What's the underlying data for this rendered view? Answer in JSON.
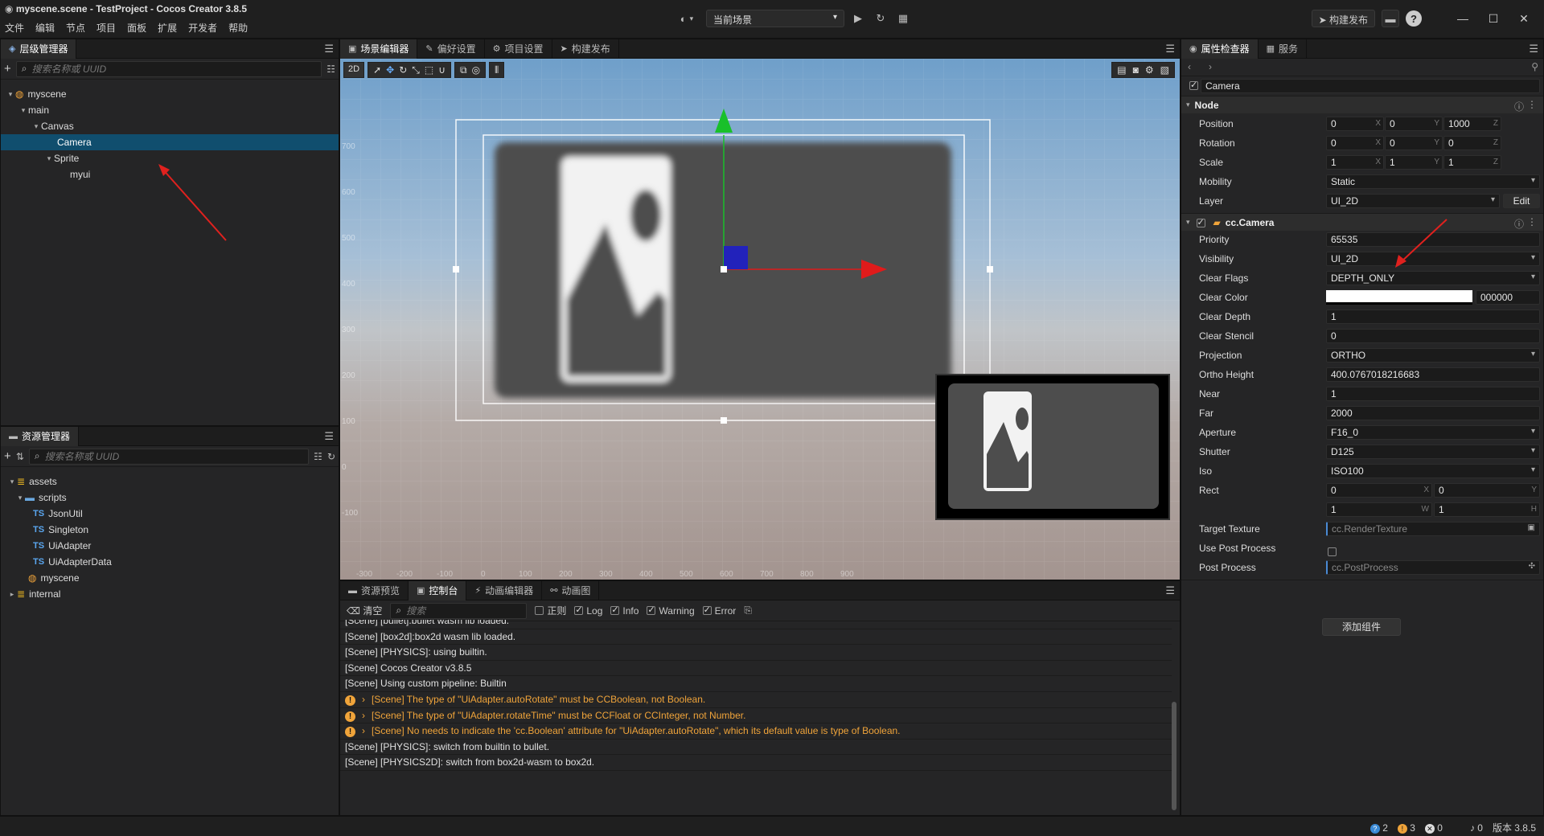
{
  "window": {
    "title": "myscene.scene - TestProject - Cocos Creator 3.8.5"
  },
  "menu": [
    "文件",
    "编辑",
    "节点",
    "项目",
    "面板",
    "扩展",
    "开发者",
    "帮助"
  ],
  "toolbar": {
    "scene_select": "当前场景",
    "build_publish": "构建发布"
  },
  "hierarchy": {
    "tab": "层级管理器",
    "search_placeholder": "搜索名称或 UUID",
    "nodes": [
      "myscene",
      "main",
      "Canvas",
      "Camera",
      "Sprite",
      "myui"
    ],
    "selected": "Camera"
  },
  "assets": {
    "tab": "资源管理器",
    "search_placeholder": "搜索名称或 UUID",
    "items": [
      "assets",
      "scripts",
      "JsonUtil",
      "Singleton",
      "UiAdapter",
      "UiAdapterData",
      "myscene",
      "internal"
    ],
    "ts_badge": "TS"
  },
  "scene_editor": {
    "tabs": [
      "场景编辑器",
      "偏好设置",
      "项目设置",
      "构建发布"
    ],
    "mode_2d": "2D",
    "y_ticks": [
      "700",
      "600",
      "500",
      "400",
      "300",
      "200",
      "100",
      "0",
      "-100"
    ],
    "x_ticks": [
      "-300",
      "-200",
      "-100",
      "0",
      "100",
      "200",
      "300",
      "400",
      "500",
      "600",
      "700",
      "800",
      "900"
    ],
    "colors": {
      "axis_x": "#e01b1b",
      "axis_y": "#19c02a",
      "gizmo_z": "#2222bb"
    }
  },
  "console": {
    "tabs": [
      "资源预览",
      "控制台",
      "动画编辑器",
      "动画图"
    ],
    "clear": "清空",
    "search_placeholder": "搜索",
    "filters": {
      "regex": "正则",
      "log": "Log",
      "info": "Info",
      "warning": "Warning",
      "error": "Error"
    },
    "lines": [
      {
        "text": "[Scene] [bullet]:bullet wasm lib loaded.",
        "type": "log"
      },
      {
        "text": "[Scene] [box2d]:box2d wasm lib loaded.",
        "type": "log"
      },
      {
        "text": "[Scene] [PHYSICS]: using builtin.",
        "type": "log"
      },
      {
        "text": "[Scene] Cocos Creator v3.8.5",
        "type": "log"
      },
      {
        "text": "[Scene] Using custom pipeline: Builtin",
        "type": "log"
      },
      {
        "text": "[Scene] The type of \"UiAdapter.autoRotate\" must be CCBoolean, not Boolean.",
        "type": "warn"
      },
      {
        "text": "[Scene] The type of \"UiAdapter.rotateTime\" must be CCFloat or CCInteger, not Number.",
        "type": "warn"
      },
      {
        "text": "[Scene] No needs to indicate the 'cc.Boolean' attribute for \"UiAdapter.autoRotate\", which its default value is type of Boolean.",
        "type": "warn"
      },
      {
        "text": "[Scene] [PHYSICS]: switch from builtin to bullet.",
        "type": "log"
      },
      {
        "text": "[Scene] [PHYSICS2D]: switch from box2d-wasm to box2d.",
        "type": "log"
      }
    ]
  },
  "inspector": {
    "tabs": [
      "属性检查器",
      "服务"
    ],
    "node_name": "Camera",
    "node_section": "Node",
    "position": [
      "0",
      "0",
      "1000"
    ],
    "rotation": [
      "0",
      "0",
      "0"
    ],
    "scale": [
      "1",
      "1",
      "1"
    ],
    "axis": [
      "X",
      "Y",
      "Z"
    ],
    "labels": {
      "position": "Position",
      "rotation": "Rotation",
      "scale": "Scale",
      "mobility": "Mobility",
      "layer": "Layer",
      "priority": "Priority",
      "visibility": "Visibility",
      "clear_flags": "Clear Flags",
      "clear_color": "Clear Color",
      "clear_depth": "Clear Depth",
      "clear_stencil": "Clear Stencil",
      "projection": "Projection",
      "ortho_height": "Ortho Height",
      "near": "Near",
      "far": "Far",
      "aperture": "Aperture",
      "shutter": "Shutter",
      "iso": "Iso",
      "rect": "Rect",
      "target_texture": "Target Texture",
      "use_post_process": "Use Post Process",
      "post_process": "Post Process"
    },
    "values": {
      "mobility": "Static",
      "layer": "UI_2D",
      "edit": "Edit",
      "priority": "65535",
      "visibility": "UI_2D",
      "clear_flags": "DEPTH_ONLY",
      "clear_color_hex": "000000",
      "clear_depth": "1",
      "clear_stencil": "0",
      "projection": "ORTHO",
      "ortho_height": "400.0767018216683",
      "near": "1",
      "far": "2000",
      "aperture": "F16_0",
      "shutter": "D125",
      "iso": "ISO100",
      "rect": [
        "0",
        "0",
        "1",
        "1"
      ],
      "rect_axis": [
        "X",
        "Y",
        "W",
        "H"
      ],
      "target_texture": "cc.RenderTexture",
      "post_process": "cc.PostProcess"
    },
    "component": "cc.Camera",
    "add_component": "添加组件"
  },
  "status": {
    "info": "2",
    "warn": "3",
    "error": "0",
    "notify": "0",
    "version": "版本 3.8.5"
  }
}
